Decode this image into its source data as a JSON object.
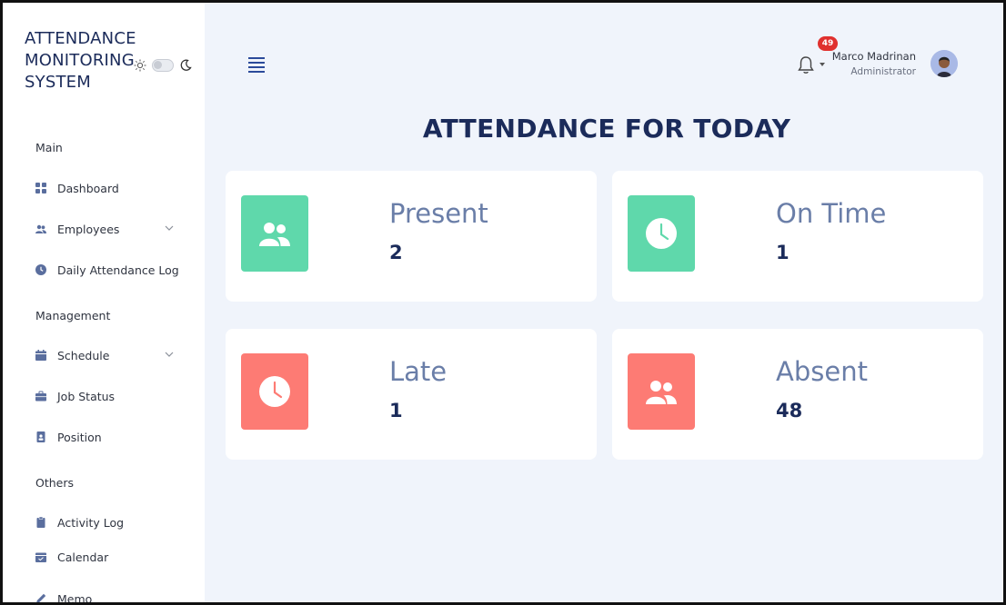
{
  "brand": {
    "line1": "ATTENDANCE",
    "line2": "MONITORING",
    "line3": "SYSTEM"
  },
  "theme": {
    "light_icon": "sun-icon",
    "dark_icon": "moon-icon",
    "toggle_on": false
  },
  "sidebar": {
    "sections": [
      {
        "title": "Main",
        "items": [
          {
            "label": "Dashboard",
            "icon": "grid-icon"
          },
          {
            "label": "Employees",
            "icon": "users-icon",
            "has_submenu": true
          },
          {
            "label": "Daily Attendance Log",
            "icon": "clock-icon"
          }
        ]
      },
      {
        "title": "Management",
        "items": [
          {
            "label": "Schedule",
            "icon": "calendar-icon",
            "has_submenu": true
          },
          {
            "label": "Job Status",
            "icon": "briefcase-icon"
          },
          {
            "label": "Position",
            "icon": "id-badge-icon"
          }
        ]
      },
      {
        "title": "Others",
        "items": [
          {
            "label": "Activity Log",
            "icon": "clipboard-icon"
          },
          {
            "label": "Calendar",
            "icon": "calendar-check-icon"
          },
          {
            "label": "Memo",
            "icon": "pen-icon"
          }
        ]
      }
    ]
  },
  "topbar": {
    "notification_count": "49",
    "user_name": "Marco Madrinan",
    "user_role": "Administrator"
  },
  "page": {
    "title": "ATTENDANCE FOR TODAY"
  },
  "cards": [
    {
      "label": "Present",
      "value": "2",
      "icon": "users-icon",
      "color": "#5fd8ab"
    },
    {
      "label": "On Time",
      "value": "1",
      "icon": "clock-icon",
      "color": "#5fd8ab"
    },
    {
      "label": "Late",
      "value": "1",
      "icon": "clock-icon",
      "color": "#fd7b74"
    },
    {
      "label": "Absent",
      "value": "48",
      "icon": "users-icon",
      "color": "#fd7b74"
    }
  ],
  "colors": {
    "navy": "#1b2b5a",
    "accent_blue": "#2b4a9a",
    "badge_red": "#e0302e",
    "background": "#f0f4fb"
  }
}
